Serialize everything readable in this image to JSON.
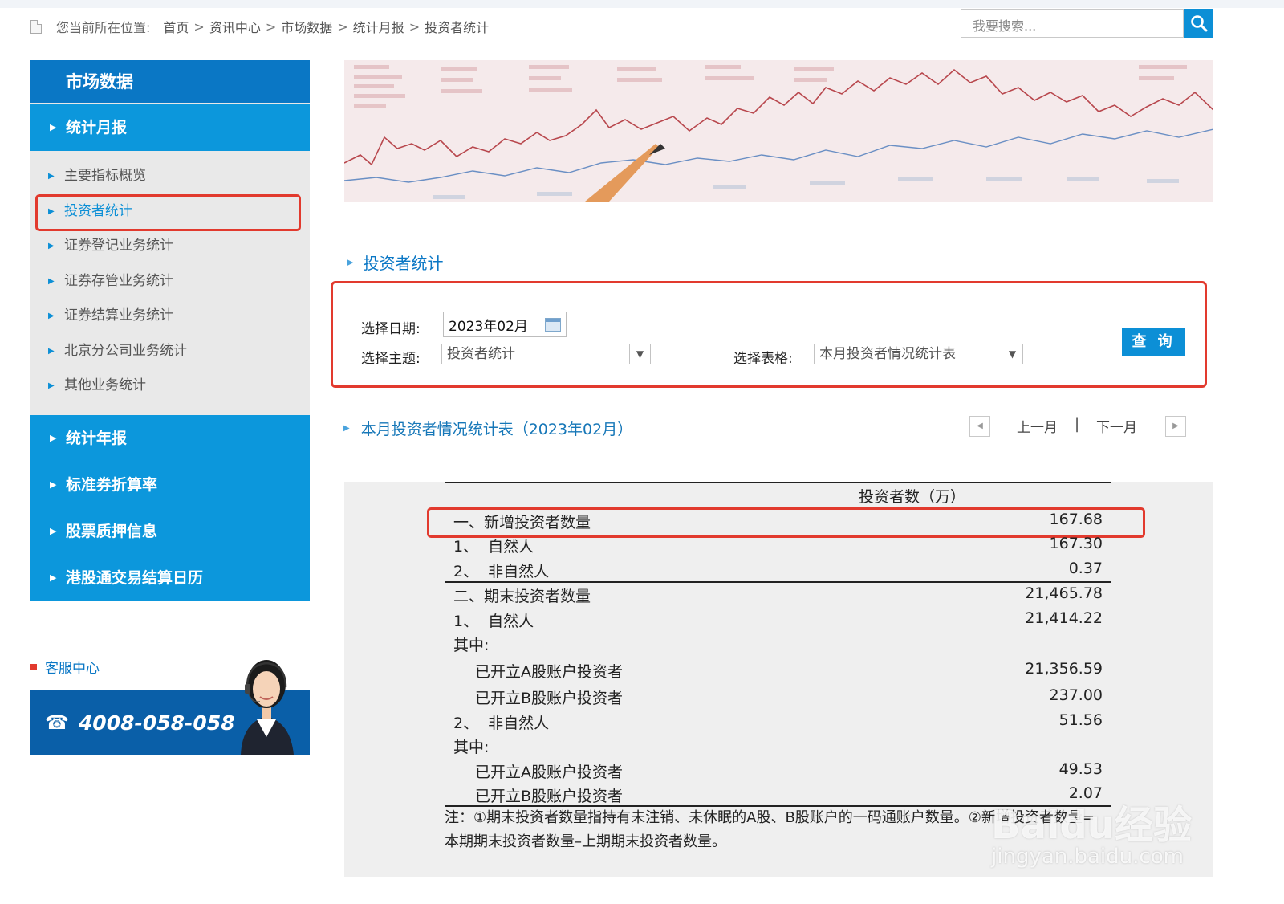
{
  "breadcrumb": {
    "prefix": "您当前所在位置:",
    "items": [
      "首页",
      "资讯中心",
      "市场数据",
      "统计月报",
      "投资者统计"
    ],
    "separator": ">"
  },
  "search": {
    "placeholder": "我要搜索..."
  },
  "sidebar": {
    "header": "市场数据",
    "active_category": "统计月报",
    "sub_items": [
      {
        "label": "主要指标概览"
      },
      {
        "label": "投资者统计",
        "active": true
      },
      {
        "label": "证券登记业务统计"
      },
      {
        "label": "证券存管业务统计"
      },
      {
        "label": "证券结算业务统计"
      },
      {
        "label": "北京分公司业务统计"
      },
      {
        "label": "其他业务统计"
      }
    ],
    "categories": [
      "统计年报",
      "标准券折算率",
      "股票质押信息",
      "港股通交易结算日历"
    ]
  },
  "service": {
    "title": "客服中心",
    "phone": "4008-058-058"
  },
  "main": {
    "section_title": "投资者统计",
    "form": {
      "date_label": "选择日期:",
      "date_value": "2023年02月",
      "topic_label": "选择主题:",
      "topic_value": "投资者统计",
      "table_label": "选择表格:",
      "table_value": "本月投资者情况统计表",
      "query_button": "查 询"
    },
    "table_title": "本月投资者情况统计表（2023年02月）",
    "pager": {
      "prev": "上一月",
      "sep": "|",
      "next": "下一月"
    },
    "table": {
      "column_header": "投资者数（万）",
      "rows": [
        {
          "label": "一、新增投资者数量",
          "value": "167.68"
        },
        {
          "label": "1、  自然人",
          "value": "167.30"
        },
        {
          "label": "2、  非自然人",
          "value": "0.37"
        },
        {
          "label": "二、期末投资者数量",
          "value": "21,465.78"
        },
        {
          "label": "1、  自然人",
          "value": "21,414.22"
        },
        {
          "label": "其中:",
          "value": ""
        },
        {
          "label": "已开立A股账户投资者",
          "value": "21,356.59"
        },
        {
          "label": "已开立B股账户投资者",
          "value": "237.00"
        },
        {
          "label": "2、  非自然人",
          "value": "51.56"
        },
        {
          "label": "其中:",
          "value": ""
        },
        {
          "label": "已开立A股账户投资者",
          "value": "49.53"
        },
        {
          "label": "已开立B股账户投资者",
          "value": "2.07"
        }
      ],
      "note": "注：①期末投资者数量指持有未注销、未休眠的A股、B股账户的一码通账户数量。②新增投资者数量=本期期末投资者数量–上期期末投资者数量。"
    }
  },
  "watermark": {
    "brand": "Baidu经验",
    "url": "jingyan.baidu.com"
  },
  "colors": {
    "primary": "#0a77c5",
    "category": "#0c97dc",
    "highlight": "#e23a2e",
    "button": "#0c8fd6"
  }
}
